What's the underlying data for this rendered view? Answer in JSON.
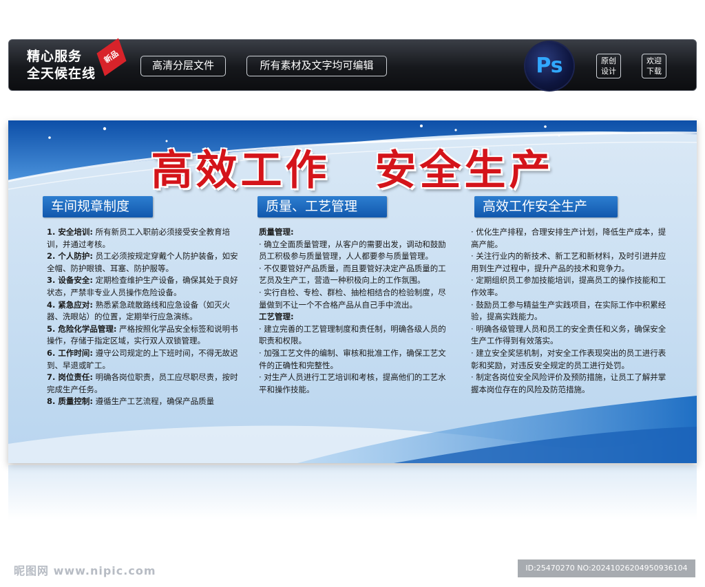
{
  "topbar": {
    "slogan_line1": "精心服务",
    "slogan_line2": "全天候在线",
    "ribbon": "新品",
    "pill1": "高清分层文件",
    "pill2": "所有素材及文字均可编辑",
    "ps_logo": "Ps",
    "box1_line1": "原创",
    "box1_line2": "设计",
    "box2_line1": "欢迎",
    "box2_line2": "下载"
  },
  "board": {
    "headline": "高效工作　安全生产",
    "col1": {
      "title": "车间规章制度",
      "items": [
        {
          "k": "1. 安全培训:",
          "t": " 所有新员工入职前必须接受安全教育培训，并通过考核。"
        },
        {
          "k": "2. 个人防护:",
          "t": " 员工必须按规定穿戴个人防护装备，如安全帽、防护眼镜、耳塞、防护服等。"
        },
        {
          "k": "3. 设备安全:",
          "t": " 定期检查维护生产设备，确保其处于良好状态，严禁非专业人员操作危险设备。"
        },
        {
          "k": "4. 紧急应对:",
          "t": " 熟悉紧急疏散路线和应急设备（如灭火器、洗眼站）的位置，定期举行应急演练。"
        },
        {
          "k": "5. 危险化学品管理:",
          "t": " 严格按照化学品安全标签和说明书操作，存储于指定区域，实行双人双锁管理。"
        },
        {
          "k": "6. 工作时间:",
          "t": " 遵守公司规定的上下班时间，不得无故迟到、早退或旷工。"
        },
        {
          "k": "7. 岗位责任:",
          "t": " 明确各岗位职责，员工应尽职尽责，按时完成生产任务。"
        },
        {
          "k": "8. 质量控制:",
          "t": " 遵循生产工艺流程，确保产品质量"
        }
      ]
    },
    "col2": {
      "title": "质量、工艺管理",
      "sec1": "质量管理:",
      "items1": [
        "·  确立全面质量管理，从客户的需要出发，调动和鼓励员工积极参与质量管理，人人都要参与质量管理。",
        "·  不仅要管好产品质量，而且要管好决定产品质量的工艺员及生产工，营造一种积极向上的工作氛围。",
        "·  实行自检、专检、群检、抽检相结合的检验制度，尽量做到不让一个不合格产品从自己手中流出。"
      ],
      "sec2": "工艺管理:",
      "items2": [
        "·  建立完善的工艺管理制度和责任制，明确各级人员的职责和权限。",
        "·  加强工艺文件的编制、审核和批准工作，确保工艺文件的正确性和完整性。",
        "·  对生产人员进行工艺培训和考核，提高他们的工艺水平和操作技能。"
      ]
    },
    "col3": {
      "title": "高效工作安全生产",
      "items": [
        "·  优化生产排程，合理安排生产计划，降低生产成本，提高产能。",
        "·  关注行业内的新技术、新工艺和新材料，及时引进并应用到生产过程中，提升产品的技术和竞争力。",
        "·  定期组织员工参加技能培训，提高员工的操作技能和工作效率。",
        "·  鼓励员工参与精益生产实践项目，在实际工作中积累经验，提高实践能力。",
        "·  明确各级管理人员和员工的安全责任和义务，确保安全生产工作得到有效落实。",
        "·  建立安全奖惩机制，对安全工作表现突出的员工进行表彰和奖励，对违反安全规定的员工进行处罚。",
        "·  制定各岗位安全风险评价及预防措施，让员工了解并掌握本岗位存在的风险及防范措施。"
      ]
    }
  },
  "footer": {
    "watermark_left": "昵图网 www.nipic.com",
    "watermark_right": "ID:25470270 NO:20241026204950936104"
  }
}
